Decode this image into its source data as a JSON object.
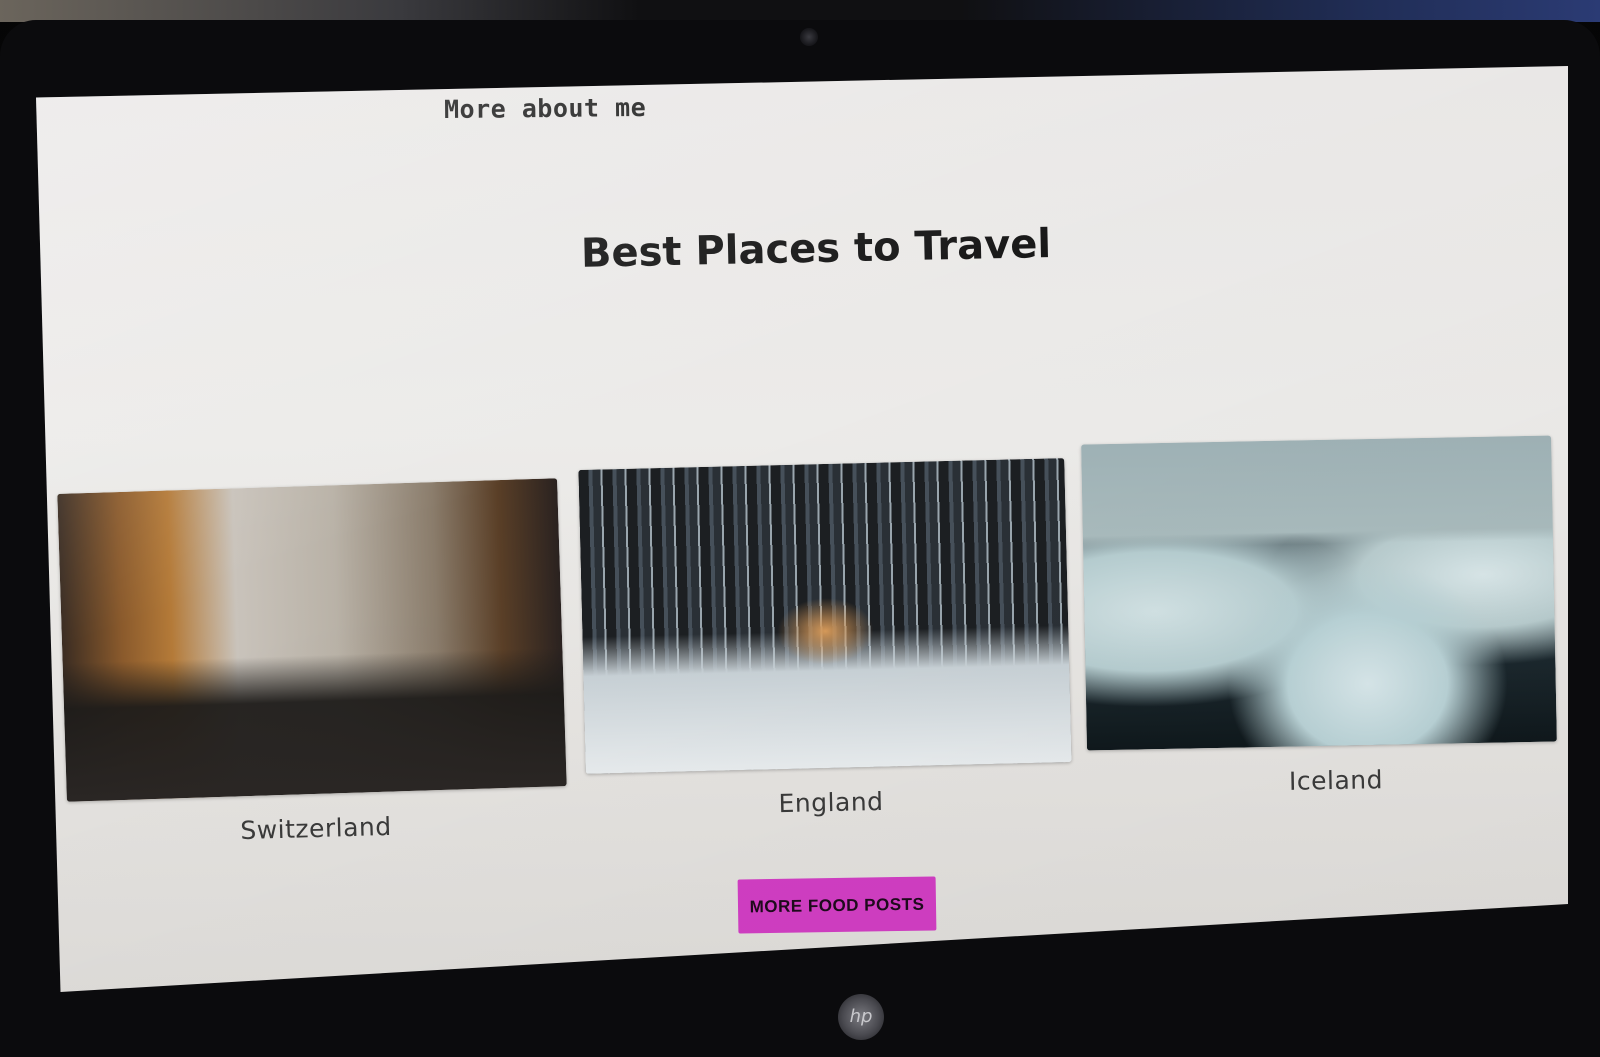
{
  "nav": {
    "about_link": "More about me"
  },
  "main": {
    "title": "Best Places to Travel"
  },
  "places": [
    {
      "name": "Switzerland"
    },
    {
      "name": "England"
    },
    {
      "name": "Iceland"
    }
  ],
  "cta": {
    "label": "MORE FOOD POSTS"
  },
  "colors": {
    "button": "#d13ec3",
    "page_background": "#ecebe9"
  },
  "icons": {
    "laptop_logo": "laptop-brand-logo-icon"
  }
}
